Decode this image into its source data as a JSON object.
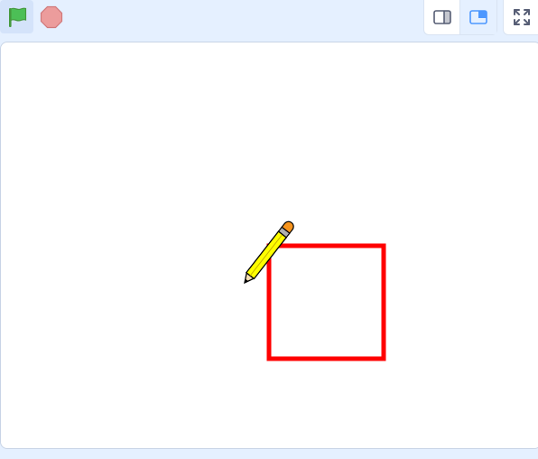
{
  "toolbar": {
    "green_flag": {
      "icon": "green-flag-icon",
      "color": "#4cbf56"
    },
    "stop": {
      "icon": "stop-sign-icon",
      "color": "#ec9c9c"
    },
    "small_stage_mode": {
      "icon": "small-stage-icon",
      "active": false
    },
    "large_stage_mode": {
      "icon": "large-stage-icon",
      "active": true,
      "accent": "#4c97ff"
    },
    "fullscreen": {
      "icon": "fullscreen-icon",
      "color": "#575e75"
    }
  },
  "stage": {
    "background": "#ffffff",
    "square_color": "#ff0000",
    "pencil_sprite": {
      "icon": "pencil-sprite-icon",
      "color": "#ffff00"
    }
  }
}
